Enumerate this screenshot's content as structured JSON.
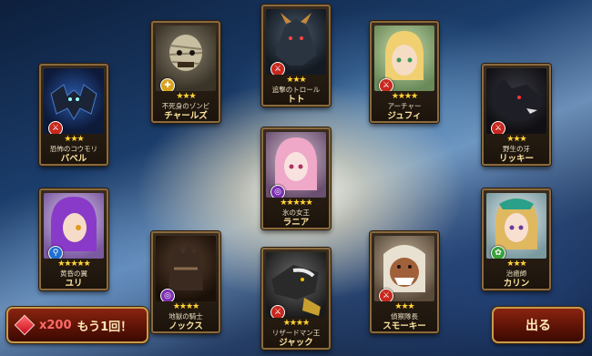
{
  "cards": [
    {
      "id": "babel",
      "title": "恐怖のコウモリ",
      "name": "バベル",
      "element": "fire",
      "stars": "★★★"
    },
    {
      "id": "charles",
      "title": "不死身のゾンビ",
      "name": "チャールズ",
      "element": "light",
      "stars": "★★★"
    },
    {
      "id": "toto",
      "title": "追撃のトロール",
      "name": "トト",
      "element": "fire",
      "stars": "★★★"
    },
    {
      "id": "jufi",
      "title": "アーチャー",
      "name": "ジュフィ",
      "element": "fire",
      "stars": "★★★★"
    },
    {
      "id": "ricky",
      "title": "野生の牙",
      "name": "リッキー",
      "element": "fire",
      "stars": "★★★"
    },
    {
      "id": "rania",
      "title": "氷の女王",
      "name": "ラニア",
      "element": "dark",
      "stars": "★★★★★"
    },
    {
      "id": "yuri",
      "title": "黄昏の翼",
      "name": "ユリ",
      "element": "water",
      "stars": "★★★★★"
    },
    {
      "id": "karin",
      "title": "治癒師",
      "name": "カリン",
      "element": "wood",
      "stars": "★★★"
    },
    {
      "id": "knox",
      "title": "地獄の騎士",
      "name": "ノックス",
      "element": "dark",
      "stars": "★★★★"
    },
    {
      "id": "jack",
      "title": "リザードマン王",
      "name": "ジャック",
      "element": "fire",
      "stars": "★★★★"
    },
    {
      "id": "smokey",
      "title": "偵察隊長",
      "name": "スモーキー",
      "element": "fire",
      "stars": "★★★"
    }
  ],
  "retry_button": {
    "cost": "x200",
    "label": "もう1回！"
  },
  "exit_button": {
    "label": "出る"
  },
  "colors": {
    "gold": "#ffd23a",
    "button_red": "#5a1206",
    "border": "#8a6a3c"
  }
}
